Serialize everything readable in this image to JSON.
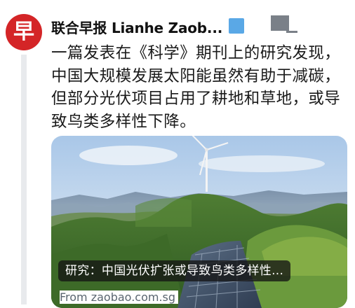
{
  "account": {
    "avatar_glyph": "早",
    "avatar_color": "#d42527",
    "name": "联合早报 Lianhe Zaob...",
    "verified_badge_color": "#5aa8e6"
  },
  "post": {
    "text": "一篇发表在《科学》期刊上的研究发现，中国大规模发展太阳能虽然有助于减碳，但部分光伏项目占用了耕地和草地，或导致鸟类多样性下降。"
  },
  "link_card": {
    "image_description_icon": "landscape-wind-turbine-solar-farm",
    "title": "研究：中国光伏扩张或导致鸟类多样性...",
    "source": "From zaobao.com.sg"
  }
}
